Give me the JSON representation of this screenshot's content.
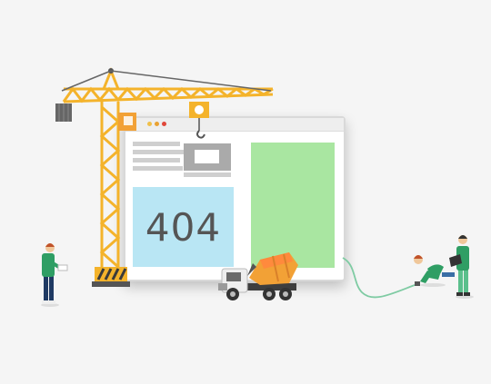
{
  "error": {
    "code": "404"
  },
  "colors": {
    "background": "#f5f5f5",
    "crane": "#f4b32b",
    "error_panel": "#b9e6f4",
    "content_panel": "#a9e6a1",
    "worker_shirt": "#2f9e64",
    "mixer_drum": "#f2a136",
    "cable": "#7fcba3"
  },
  "icons": {
    "crane": "crane-icon",
    "truck": "cement-mixer-truck-icon",
    "worker_left": "worker-with-tablet-icon",
    "worker_kneeling": "kneeling-worker-icon",
    "worker_laptop": "worker-with-laptop-icon"
  }
}
